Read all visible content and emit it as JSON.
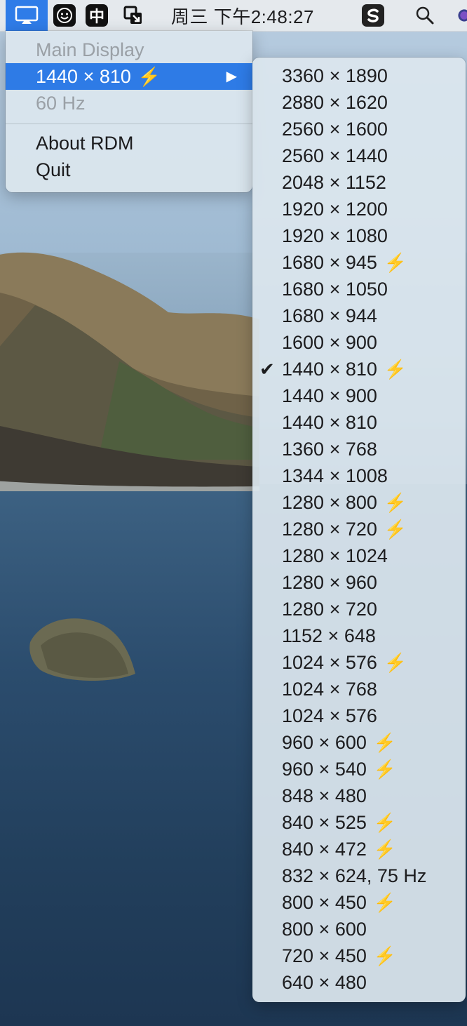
{
  "menubar": {
    "clock": "周三 下午2:48:27",
    "icons": [
      "rdm-display-icon",
      "smile-face-icon",
      "chinese-input-icon",
      "window-switch-icon",
      "s-app-icon",
      "search-icon",
      "color-wheel-icon"
    ],
    "chinese_input_label": "中"
  },
  "main_menu": {
    "header": "Main Display",
    "current_resolution": "1440 × 810",
    "refresh_rate": "60 Hz",
    "about": "About RDM",
    "quit": "Quit"
  },
  "submenu": {
    "items": [
      {
        "label": "3360 × 1890",
        "hidpi": false,
        "checked": false
      },
      {
        "label": "2880 × 1620",
        "hidpi": false,
        "checked": false
      },
      {
        "label": "2560 × 1600",
        "hidpi": false,
        "checked": false
      },
      {
        "label": "2560 × 1440",
        "hidpi": false,
        "checked": false
      },
      {
        "label": "2048 × 1152",
        "hidpi": false,
        "checked": false
      },
      {
        "label": "1920 × 1200",
        "hidpi": false,
        "checked": false
      },
      {
        "label": "1920 × 1080",
        "hidpi": false,
        "checked": false
      },
      {
        "label": "1680 × 945",
        "hidpi": true,
        "checked": false
      },
      {
        "label": "1680 × 1050",
        "hidpi": false,
        "checked": false
      },
      {
        "label": "1680 × 944",
        "hidpi": false,
        "checked": false
      },
      {
        "label": "1600 × 900",
        "hidpi": false,
        "checked": false
      },
      {
        "label": "1440 × 810",
        "hidpi": true,
        "checked": true
      },
      {
        "label": "1440 × 900",
        "hidpi": false,
        "checked": false
      },
      {
        "label": "1440 × 810",
        "hidpi": false,
        "checked": false
      },
      {
        "label": "1360 × 768",
        "hidpi": false,
        "checked": false
      },
      {
        "label": "1344 × 1008",
        "hidpi": false,
        "checked": false
      },
      {
        "label": "1280 × 800",
        "hidpi": true,
        "checked": false
      },
      {
        "label": "1280 × 720",
        "hidpi": true,
        "checked": false
      },
      {
        "label": "1280 × 1024",
        "hidpi": false,
        "checked": false
      },
      {
        "label": "1280 × 960",
        "hidpi": false,
        "checked": false
      },
      {
        "label": "1280 × 720",
        "hidpi": false,
        "checked": false
      },
      {
        "label": "1152 × 648",
        "hidpi": false,
        "checked": false
      },
      {
        "label": "1024 × 576",
        "hidpi": true,
        "checked": false
      },
      {
        "label": "1024 × 768",
        "hidpi": false,
        "checked": false
      },
      {
        "label": "1024 × 576",
        "hidpi": false,
        "checked": false
      },
      {
        "label": "960 × 600",
        "hidpi": true,
        "checked": false
      },
      {
        "label": "960 × 540",
        "hidpi": true,
        "checked": false
      },
      {
        "label": "848 × 480",
        "hidpi": false,
        "checked": false
      },
      {
        "label": "840 × 525",
        "hidpi": true,
        "checked": false
      },
      {
        "label": "840 × 472",
        "hidpi": true,
        "checked": false
      },
      {
        "label": "832 × 624, 75 Hz",
        "hidpi": false,
        "checked": false
      },
      {
        "label": "800 × 450",
        "hidpi": true,
        "checked": false
      },
      {
        "label": "800 × 600",
        "hidpi": false,
        "checked": false
      },
      {
        "label": "720 × 450",
        "hidpi": true,
        "checked": false
      },
      {
        "label": "640 × 480",
        "hidpi": false,
        "checked": false
      }
    ]
  },
  "colors": {
    "highlight": "#2e7be6",
    "bolt": "#f0c43a"
  }
}
